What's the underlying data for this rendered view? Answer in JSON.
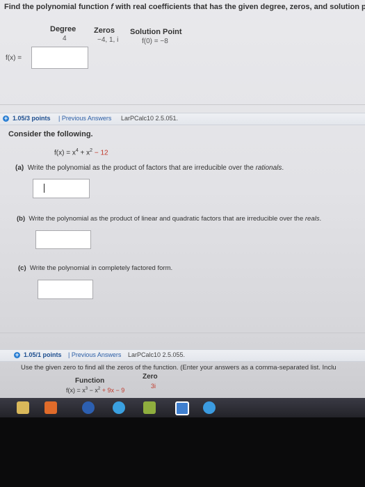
{
  "question1": {
    "prompt_pre": "Find the polynomial function ",
    "prompt_var": "f",
    "prompt_post": " with real coefficients that has the given degree, zeros, and solution point.",
    "headers": {
      "degree": "Degree",
      "zeros": "Zeros",
      "solution_point": "Solution Point"
    },
    "values": {
      "degree": "4",
      "zeros": "−4, 1, i",
      "solution_point": "f(0) = −8"
    },
    "answer_label": "f(x) =",
    "answer_value": ""
  },
  "question2": {
    "points": "1.05/3 points",
    "previous_answers": "Previous Answers",
    "source": "LarPCalc10 2.5.051.",
    "intro": "Consider the following.",
    "function": {
      "lhs": "f(x) = x",
      "exp1": "4",
      "mid": " + x",
      "exp2": "2",
      "rhs": " − 12"
    },
    "parts": [
      {
        "label": "(a)",
        "text_pre": "Write the polynomial as the product of factors that are irreducible over the ",
        "text_em": "rationals",
        "text_post": ".",
        "value": ""
      },
      {
        "label": "(b)",
        "text_pre": "Write the polynomial as the product of linear and quadratic factors that are irreducible over the ",
        "text_em": "reals",
        "text_post": ".",
        "value": ""
      },
      {
        "label": "(c)",
        "text_pre": "Write the polynomial in completely factored form.",
        "text_em": "",
        "text_post": "",
        "value": ""
      }
    ]
  },
  "question3": {
    "points": "1.05/1 points",
    "previous_answers": "Previous Answers",
    "source": "LarPCalc10 2.5.055.",
    "instruction": "Use the given zero to find all the zeros of the function. (Enter your answers as a comma-separated list. Inclu",
    "headers": {
      "function": "Function",
      "zero": "Zero"
    },
    "function": {
      "lhs": "f(x) = x",
      "exp1": "3",
      "mid": " − x",
      "exp2": "2",
      "rhs": " + 9x − 9"
    },
    "zero": "3i"
  },
  "taskbar": {
    "icons": [
      "folder-icon",
      "media-player-icon",
      "hp-icon",
      "chrome-icon",
      "network-icon",
      "app-icon",
      "edge-icon"
    ]
  },
  "colors": {
    "link": "#2b5ea6",
    "points": "#1d4e8f",
    "badge": "#2b7fd3",
    "accent_red": "#c0392b"
  }
}
